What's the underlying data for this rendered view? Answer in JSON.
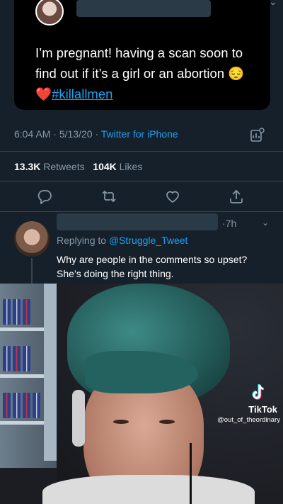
{
  "tweet": {
    "text_line1": "I’m pregnant! having a scan soon to",
    "text_line2": "find out if it’s a girl or an abortion 😔",
    "hashtag": "#killallmen",
    "time": "6:04 AM",
    "date": "5/13/20",
    "source": "Twitter for iPhone",
    "retweets_count": "13.3K",
    "retweets_label": "Retweets",
    "likes_count": "104K",
    "likes_label": "Likes"
  },
  "reply": {
    "time": "7h",
    "replying_label": "Replying to",
    "replying_handle": "@Struggle_Tweet",
    "text": "Why are people in the comments so upset? She’s doing the right thing."
  },
  "tiktok": {
    "brand": "TikTok",
    "username": "@out_of_theordinary"
  },
  "colors": {
    "background": "#15202b",
    "accent": "#1da1f2",
    "muted": "#8899a6"
  },
  "icons": [
    "reply-icon",
    "retweet-icon",
    "like-icon",
    "share-icon",
    "analytics-icon",
    "tiktok-logo-icon",
    "chevron-down-icon",
    "more-icon"
  ]
}
